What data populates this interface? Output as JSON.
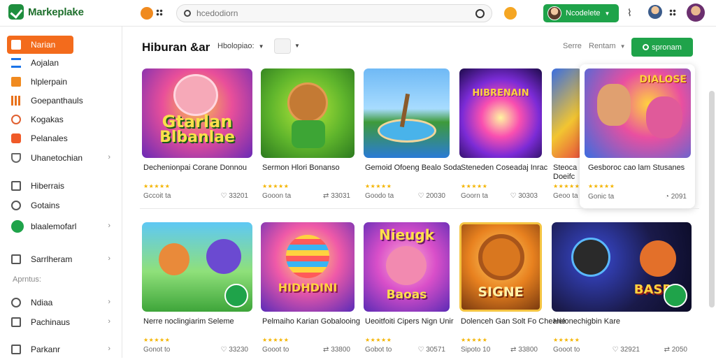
{
  "app": {
    "name": "Markeplake"
  },
  "search": {
    "placeholder": "hcedodiorn"
  },
  "account": {
    "label": "Ncodelete"
  },
  "sidebar": {
    "items": [
      {
        "label": "Narian"
      },
      {
        "label": "Aojalan"
      },
      {
        "label": "hlplerpain"
      },
      {
        "label": "Goepanthauls"
      },
      {
        "label": "Kogakas"
      },
      {
        "label": "Pelanales"
      },
      {
        "label": "Uhanetochian"
      },
      {
        "label": "Hiberrais"
      },
      {
        "label": "Gotains"
      },
      {
        "label": "blaalemofarl"
      },
      {
        "label": "Sarrlheram"
      },
      {
        "label": "Ndiaa"
      },
      {
        "label": "Pachinaus"
      },
      {
        "label": "Parkanr"
      }
    ],
    "section_label": "Aprntus:"
  },
  "main": {
    "title": "Hiburan &ar",
    "filter1": "Hbolopiao:",
    "sort_label": "Serre",
    "sort_value": "Rentam",
    "cta_label": "spronam"
  },
  "cards": [
    {
      "title": "Dechenionpai Corane Donnou",
      "left": "Gccoit ta",
      "right": "33201"
    },
    {
      "title": "Sermon Hlori Bonanso",
      "left": "Gooon ta",
      "right": "33031"
    },
    {
      "title": "Gemoid Ofoeng Bealo Soda",
      "left": "Goodo ta",
      "right": "20030"
    },
    {
      "title": "Steneden Coseadaj Inrac",
      "left": "Goorn ta",
      "right": "30303"
    },
    {
      "title": "Steoca Doeifc",
      "left": "Geoo ta",
      "right": ""
    },
    {
      "title": "Gesboroc cao lam Stusanes",
      "left": "Gonic ta",
      "right": "2091"
    },
    {
      "title": "Nerre noclingiarim Seleme",
      "left": "Gonot to",
      "right": "33230"
    },
    {
      "title": "Pelmaiho Karian Gobalooing",
      "left": "Gooot to",
      "right": "33800"
    },
    {
      "title": "Ueoitfoiti Cipers Nign Unir",
      "left": "Gobot to",
      "right": "30571"
    },
    {
      "title": "Dolenceh Gan Solt Fo Chearie",
      "left": "Sipoto 10",
      "right": "33800"
    },
    {
      "title": "Helonechigbin Kare",
      "left": "Gooot to",
      "right": "32921"
    },
    {
      "title": "",
      "left": "",
      "right": "2050"
    }
  ],
  "thumb_text": {
    "t1a": "Gtarlan",
    "t1b": "Blbanlae",
    "t4": "HIBRENAIN",
    "t6": "DIALOSE",
    "t8": "HIDHDINI",
    "t9a": "Nieugk",
    "t9b": "Baoas",
    "t10": "SIGNE",
    "t11": "BASR"
  },
  "colors": {
    "accent": "#1fa34a",
    "active_nav": "#f36b1c"
  }
}
